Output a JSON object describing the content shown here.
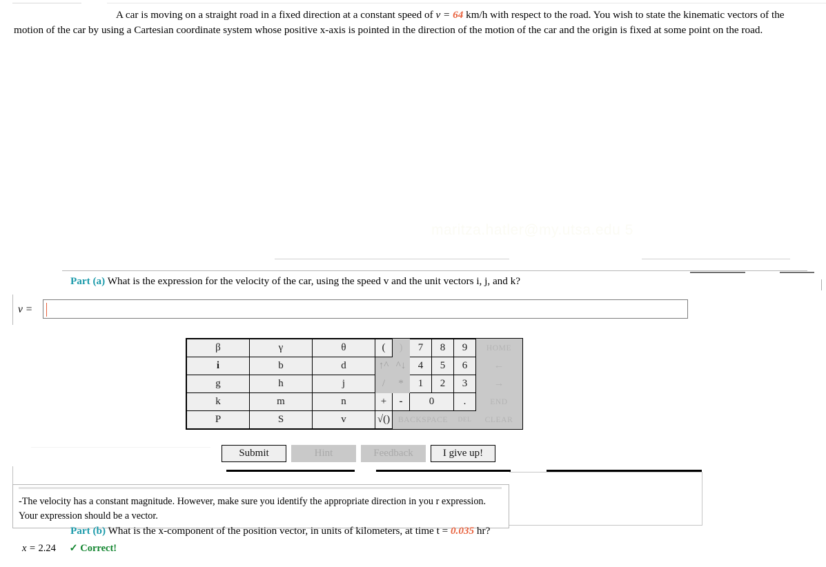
{
  "problem": {
    "text_before_value": "A car is moving on a straight road in a fixed direction at a constant speed of ",
    "speed_symbol": "v = ",
    "speed_value": "64",
    "text_after_value": " km/h with respect to the road. You wish to state the kinematic vectors of the motion of the car by using a Cartesian coordinate system whose positive x-axis is pointed in the direction of the motion of the car and the origin is fixed at some point on the road."
  },
  "watermark": {
    "text": "maritza.hatler@my.utsa.edu 5"
  },
  "part_a": {
    "label": "Part (a)",
    "question": "What is the expression for the velocity of the car, using the speed v and the unit vectors i, j, and k?",
    "answer_variable": "v =",
    "answer_value": "",
    "answer_placeholder": ""
  },
  "keypad": {
    "rows": [
      [
        {
          "label": "β",
          "kind": "sym"
        },
        {
          "label": "γ",
          "kind": "sym"
        },
        {
          "label": "θ",
          "kind": "sym"
        },
        {
          "label": "(",
          "kind": "paren"
        },
        {
          "label": ")",
          "kind": "paren-disabled"
        },
        {
          "label": "7",
          "kind": "num"
        },
        {
          "label": "8",
          "kind": "num"
        },
        {
          "label": "9",
          "kind": "num"
        },
        {
          "label": "HOME",
          "kind": "nav-disabled"
        }
      ],
      [
        {
          "label": "i",
          "kind": "sym-bold"
        },
        {
          "label": "b",
          "kind": "sym"
        },
        {
          "label": "d",
          "kind": "sym"
        },
        {
          "label": "↑^",
          "kind": "op-disabled"
        },
        {
          "label": "^↓",
          "kind": "op-disabled"
        },
        {
          "label": "4",
          "kind": "num"
        },
        {
          "label": "5",
          "kind": "num"
        },
        {
          "label": "6",
          "kind": "num"
        },
        {
          "label": "←",
          "kind": "nav-disabled"
        }
      ],
      [
        {
          "label": "g",
          "kind": "sym"
        },
        {
          "label": "h",
          "kind": "sym"
        },
        {
          "label": "j",
          "kind": "sym"
        },
        {
          "label": "/",
          "kind": "op-disabled"
        },
        {
          "label": "*",
          "kind": "op-disabled"
        },
        {
          "label": "1",
          "kind": "num"
        },
        {
          "label": "2",
          "kind": "num"
        },
        {
          "label": "3",
          "kind": "num"
        },
        {
          "label": "→",
          "kind": "nav-disabled"
        }
      ],
      [
        {
          "label": "k",
          "kind": "sym"
        },
        {
          "label": "m",
          "kind": "sym"
        },
        {
          "label": "n",
          "kind": "sym"
        },
        {
          "label": "+",
          "kind": "paren"
        },
        {
          "label": "-",
          "kind": "paren"
        },
        {
          "label": "0",
          "kind": "num-wide"
        },
        {
          "label": ".",
          "kind": "num"
        },
        {
          "label": "END",
          "kind": "nav-disabled"
        }
      ],
      [
        {
          "label": "P",
          "kind": "sym"
        },
        {
          "label": "S",
          "kind": "sym"
        },
        {
          "label": "v",
          "kind": "sym"
        },
        {
          "label": "√()",
          "kind": "paren"
        },
        {
          "label": "BACKSPACE",
          "kind": "backspace-disabled"
        },
        {
          "label": "DEL",
          "kind": "del-disabled"
        },
        {
          "label": "CLEAR",
          "kind": "nav-disabled"
        }
      ]
    ]
  },
  "actions": {
    "submit": "Submit",
    "hint": "Hint",
    "feedback": "Feedback",
    "give_up": "I give up!"
  },
  "hint_box": {
    "text": "-The velocity has a constant magnitude. However, make sure you identify the appropriate direction in you r expression. Your expression should be a vector."
  },
  "part_b": {
    "label": "Part (b)",
    "question_before": "What is the x-component of the position vector, in units of kilometers, at time t = ",
    "time_value": "0.035",
    "question_after": " hr?",
    "answer_variable": "x = ",
    "answer_value": "2.24",
    "status_icon": "✓",
    "status_text": "Correct!"
  },
  "colors": {
    "accent_part_label": "#1b9aaa",
    "given_value": "#e8603c",
    "correct": "#12852f",
    "keypad_enabled_bg": "#efefef",
    "keypad_disabled_bg": "#c9c9c9",
    "caret": "#e8603c"
  }
}
